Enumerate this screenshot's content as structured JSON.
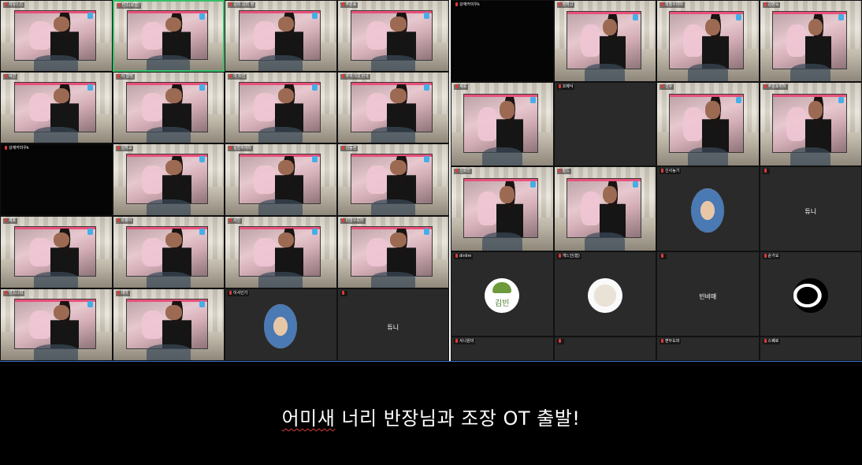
{
  "left_grid": {
    "cols": 4,
    "rows": 5,
    "tiles": [
      {
        "name": "자유(나)",
        "kind": "video",
        "share": true
      },
      {
        "name": "번스(로컬)",
        "kind": "video",
        "share": true,
        "active": true
      },
      {
        "name": "김리 김리 영",
        "kind": "video",
        "share": true
      },
      {
        "name": "주원송",
        "kind": "video",
        "share": true
      },
      {
        "name": "덕선",
        "kind": "video",
        "share": true
      },
      {
        "name": "어 형명",
        "kind": "video",
        "share": true
      },
      {
        "name": "이 미진",
        "kind": "video",
        "share": true
      },
      {
        "name": "추석기대 현사",
        "kind": "video",
        "share": true
      },
      {
        "name": "강재카미우k",
        "kind": "black",
        "share": false
      },
      {
        "name": "일하교",
        "kind": "video",
        "share": true
      },
      {
        "name": "실전하어라",
        "kind": "video",
        "share": true
      },
      {
        "name": "김동현",
        "kind": "video",
        "share": true
      },
      {
        "name": "제호",
        "kind": "video",
        "share": true
      },
      {
        "name": "트랭이",
        "kind": "video",
        "share": true
      },
      {
        "name": "서인",
        "kind": "video",
        "share": true
      },
      {
        "name": "미엉우프러",
        "kind": "video",
        "share": true
      },
      {
        "name": "번스나리",
        "kind": "video",
        "share": true
      },
      {
        "name": "테어",
        "kind": "video",
        "share": true
      },
      {
        "name": "이서인기",
        "kind": "avatar",
        "avatar": "pinup"
      },
      {
        "name": "",
        "kind": "text",
        "center_name": "튜니"
      }
    ]
  },
  "right_grid": {
    "cols": 4,
    "rows": 5,
    "tiles": [
      {
        "name": "강재카미우k",
        "kind": "black",
        "share": false
      },
      {
        "name": "정하고",
        "kind": "video",
        "share": true
      },
      {
        "name": "최정우야야",
        "kind": "video",
        "share": true
      },
      {
        "name": "김현욱",
        "kind": "video",
        "share": true
      },
      {
        "name": "새로",
        "kind": "video",
        "share": true
      },
      {
        "name": "코제닉",
        "kind": "dark",
        "share": false
      },
      {
        "name": "선우",
        "kind": "video",
        "share": true
      },
      {
        "name": "주성호히히",
        "kind": "video",
        "share": true
      },
      {
        "name": "신희진",
        "kind": "video",
        "share": true
      },
      {
        "name": "말느",
        "kind": "video",
        "share": true
      },
      {
        "name": "신사농기",
        "kind": "avatar",
        "avatar": "pinup"
      },
      {
        "name": "",
        "kind": "text",
        "center_name": "튜니"
      },
      {
        "name": "dinlim",
        "kind": "avatar",
        "avatar": "turtle",
        "avatar_label": "김빈"
      },
      {
        "name": "개느인(협)",
        "kind": "avatar",
        "avatar": "cloth"
      },
      {
        "name": "",
        "kind": "text",
        "center_name": "빈바매"
      },
      {
        "name": "순가요",
        "kind": "avatar",
        "avatar": "bw"
      },
      {
        "name": "서나원의",
        "kind": "dark",
        "share": false
      },
      {
        "name": "",
        "kind": "dark",
        "share": false
      },
      {
        "name": "편두도와",
        "kind": "dark",
        "share": false
      },
      {
        "name": "스퀘로",
        "kind": "dark",
        "share": false
      }
    ]
  },
  "subtitle": {
    "word_marked": "어미새",
    "rest": " 너리 반장님과 조장 OT 출발!"
  },
  "colors": {
    "active_border": "#36c06a",
    "subtitle_bg": "#000000",
    "subtitle_text": "#ffffff",
    "mic_muted": "#e03a3a"
  }
}
